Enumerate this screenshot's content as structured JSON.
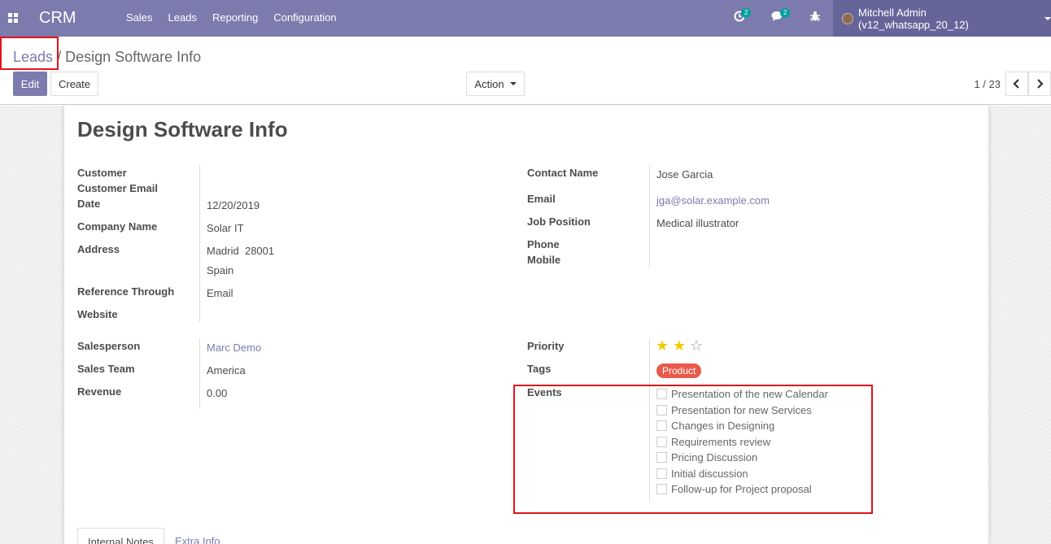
{
  "navbar": {
    "brand": "CRM",
    "menu": [
      "Sales",
      "Leads",
      "Reporting",
      "Configuration"
    ],
    "activity_count": "2",
    "messages_count": "2",
    "user": "Mitchell Admin (v12_whatsapp_20_12)"
  },
  "breadcrumb": {
    "parent": "Leads",
    "separator": "/",
    "current": "Design Software Info"
  },
  "buttons": {
    "edit": "Edit",
    "create": "Create",
    "action": "Action"
  },
  "pager": {
    "value": "1 / 23"
  },
  "record": {
    "title": "Design Software Info",
    "left": [
      {
        "label": "Customer",
        "value": ""
      },
      {
        "label": "Customer Email",
        "value": ""
      },
      {
        "label": "Date",
        "value": "12/20/2019"
      },
      {
        "label": "Company Name",
        "value": "Solar IT"
      },
      {
        "label": "Address",
        "value": "Madrid  28001",
        "value2": "Spain"
      },
      {
        "label": "Reference Through",
        "value": "Email"
      },
      {
        "label": "Website",
        "value": ""
      }
    ],
    "right": [
      {
        "label": "Contact Name",
        "value": "Jose Garcia"
      },
      {
        "label": "Email",
        "value": "jga@solar.example.com"
      },
      {
        "label": "Job Position",
        "value": "Medical illustrator"
      },
      {
        "label": "Phone",
        "value": ""
      },
      {
        "label": "Mobile",
        "value": ""
      }
    ],
    "left2": [
      {
        "label": "Salesperson",
        "value": "Marc Demo"
      },
      {
        "label": "Sales Team",
        "value": "America"
      },
      {
        "label": "Revenue",
        "value": "0.00"
      }
    ],
    "priority_label": "Priority",
    "priority": {
      "value": 2,
      "max": 3
    },
    "tags_label": "Tags",
    "tags": [
      "Product"
    ],
    "events_label": "Events",
    "events": [
      "Presentation of the new Calendar",
      "Presentation for new Services",
      "Changes in Designing",
      "Requirements review",
      "Pricing Discussion",
      "Initial discussion",
      "Follow-up for Project proposal"
    ]
  },
  "tabs": [
    "Internal Notes",
    "Extra Info"
  ],
  "colors": {
    "navbar": "#7c7bad",
    "accent": "#7c7bad",
    "tag": "#e95a4a",
    "star": "#f3cc00",
    "highlight": "#e3131b"
  }
}
